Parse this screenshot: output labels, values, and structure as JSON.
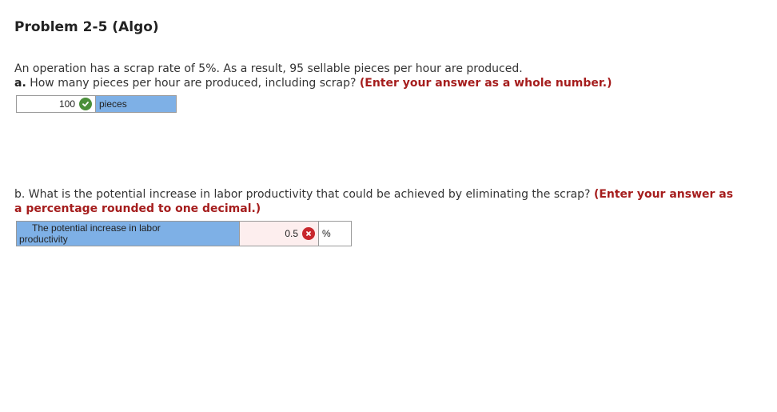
{
  "problem": {
    "title": "Problem 2-5 (Algo)",
    "intro": "An operation has a scrap rate of 5%. As a result, 95 sellable pieces per hour are produced."
  },
  "part_a": {
    "label": "a.",
    "question": " How many pieces per hour are produced, including scrap? ",
    "instruction": "(Enter your answer as a whole number.)",
    "answer_value": "100",
    "status_icon": "check-icon",
    "status": "correct",
    "unit": "pieces"
  },
  "part_b": {
    "question": "b. What is the potential increase in labor productivity that could be achieved by eliminating the scrap? ",
    "instruction": "(Enter your answer as a percentage rounded to one decimal.)",
    "field_label_line1": "The potential increase in labor",
    "field_label_line2": "productivity",
    "answer_value": "0.5",
    "status_icon": "x-icon",
    "status": "incorrect",
    "unit": "%"
  },
  "colors": {
    "instruction": "#a51d1d",
    "label_fill": "#7eb0e6",
    "correct": "#4b8f3a",
    "incorrect": "#c8262c",
    "incorrect_field": "#fdeeee"
  }
}
